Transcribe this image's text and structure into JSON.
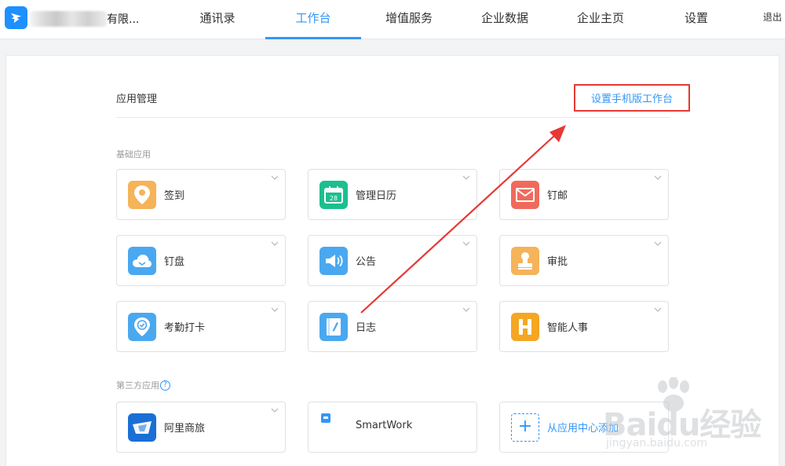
{
  "header": {
    "company_name": "有限...",
    "nav": [
      {
        "label": "通讯录",
        "active": false
      },
      {
        "label": "工作台",
        "active": true
      },
      {
        "label": "增值服务",
        "active": false
      },
      {
        "label": "企业数据",
        "active": false
      },
      {
        "label": "企业主页",
        "active": false
      },
      {
        "label": "设置",
        "active": false
      }
    ],
    "logout_label": "退出"
  },
  "main": {
    "title": "应用管理",
    "mobile_workbench_link": "设置手机版工作台",
    "basic_section_label": "基础应用",
    "basic_apps": [
      {
        "name": "签到",
        "icon": "location-pin-icon",
        "color": "#f5b35a"
      },
      {
        "name": "管理日历",
        "icon": "calendar-icon",
        "color": "#1cbf8f"
      },
      {
        "name": "钉邮",
        "icon": "mail-icon",
        "color": "#f06a5c"
      },
      {
        "name": "钉盘",
        "icon": "cloud-icon",
        "color": "#4aa8f0"
      },
      {
        "name": "公告",
        "icon": "megaphone-icon",
        "color": "#4aa8f0"
      },
      {
        "name": "审批",
        "icon": "stamp-icon",
        "color": "#f5b35a"
      },
      {
        "name": "考勤打卡",
        "icon": "checkin-pin-icon",
        "color": "#4aa8f0"
      },
      {
        "name": "日志",
        "icon": "notebook-icon",
        "color": "#4aa8f0"
      },
      {
        "name": "智能人事",
        "icon": "hr-h-icon",
        "color": "#f5a623"
      }
    ],
    "third_party_section_label": "第三方应用",
    "third_party_apps": [
      {
        "name": "阿里商旅",
        "icon": "ali-travel-icon",
        "color": "#1a6fd6"
      },
      {
        "name": "SmartWork",
        "icon": "smartwork-icon",
        "color": "#3296fa"
      }
    ],
    "add_from_center_label": "从应用中心添加"
  },
  "watermark": {
    "main": "Baidu经验",
    "sub": "jingyan.baidu.com"
  },
  "colors": {
    "accent": "#3296fa",
    "highlight_box": "#e53935",
    "arrow": "#e53935"
  }
}
